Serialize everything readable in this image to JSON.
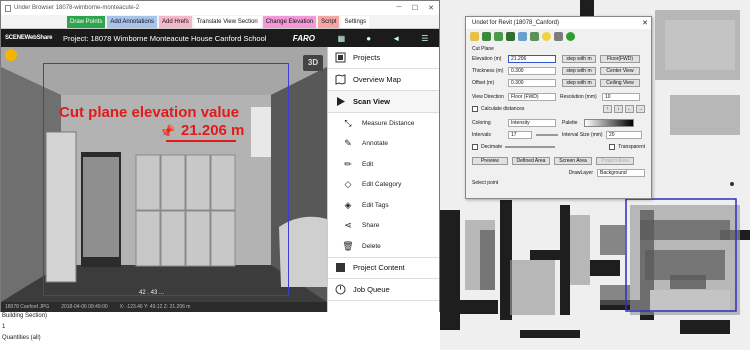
{
  "browser": {
    "title": "Under Browser 18078-wimborne-monteacute-2",
    "bookmarks": [
      {
        "label": "Draw Points",
        "color": "#2ea44f",
        "text": "#ffffff"
      },
      {
        "label": "Add Annotations",
        "color": "#a8c4ea",
        "text": "#111111"
      },
      {
        "label": "Add Hrefs",
        "color": "#f4b8c8",
        "text": "#111111"
      },
      {
        "label": "Translate View Section",
        "color": "#ffffff",
        "text": "#111111"
      },
      {
        "label": "Change Elevation",
        "color": "#f29ad8",
        "text": "#111111"
      },
      {
        "label": "Script",
        "color": "#f7a6a6",
        "text": "#111111"
      },
      {
        "label": "Settings",
        "color": "#ffffff",
        "text": "#111111"
      }
    ],
    "app_logo": "SCENEWebShare",
    "project_title": "Project: 18078 Wimborne Monteacute House Canford School",
    "brand": "FARO",
    "view_3d": "3D",
    "status_text": [
      "18078 Canford JPG",
      "2018-04-06 08:49:00",
      "X: -123.46 Y: 49.12 Z: 21.206 m"
    ],
    "nav_label": "42 . 43 ..."
  },
  "annotation": {
    "label": "Cut plane elevation value",
    "value": "21.206 m"
  },
  "sidebar": {
    "projects": "Projects",
    "overview_map": "Overview Map",
    "scan_view": "Scan View",
    "sub_items": [
      "Measure Distance",
      "Annotate",
      "Edit",
      "Edit Category",
      "Edit Tags",
      "Share",
      "Delete"
    ],
    "project_content": "Project Content",
    "job_queue": "Job Queue"
  },
  "revit_browser": {
    "lines": [
      "Building Section)",
      "1",
      "Quantities (all)"
    ]
  },
  "dialog": {
    "title": "Undet for Revit (18078_Canford)",
    "section": "Cut Plane",
    "elevation_label": "Elevation (m)",
    "elevation_value": "21.206",
    "thickness_label": "Thickness (m)",
    "thickness_value": "0.300",
    "offset_label": "Offset (m)",
    "offset_value": "0.300",
    "step_label": "step with m",
    "floor_btn": "Floor(FWD)",
    "center_btn": "Center View",
    "ceiling_btn": "Ceiling View",
    "view_direction_label": "View Direction",
    "view_direction_value": "Floor (FWD)",
    "resolution_label": "Resolution (mm)",
    "resolution_value": "10",
    "calc_distances": "Calculate distances",
    "coloring_label": "Coloring",
    "coloring_value": "Intensity",
    "palette_label": "Palette",
    "intervals_label": "Intervals",
    "intervals_value": "17",
    "interval_size_label": "Interval Size (mm)",
    "interval_size_value": "20",
    "decimate": "Decimate",
    "transparent": "Transparent",
    "preview_btn": "Preview",
    "defined_area_btn": "Defined Area",
    "screen_area_btn": "Screen Area",
    "disabled_btn": "Project Area",
    "draw_layer_label": "DrawLayer",
    "draw_layer_value": "Background",
    "status": "Select point"
  }
}
